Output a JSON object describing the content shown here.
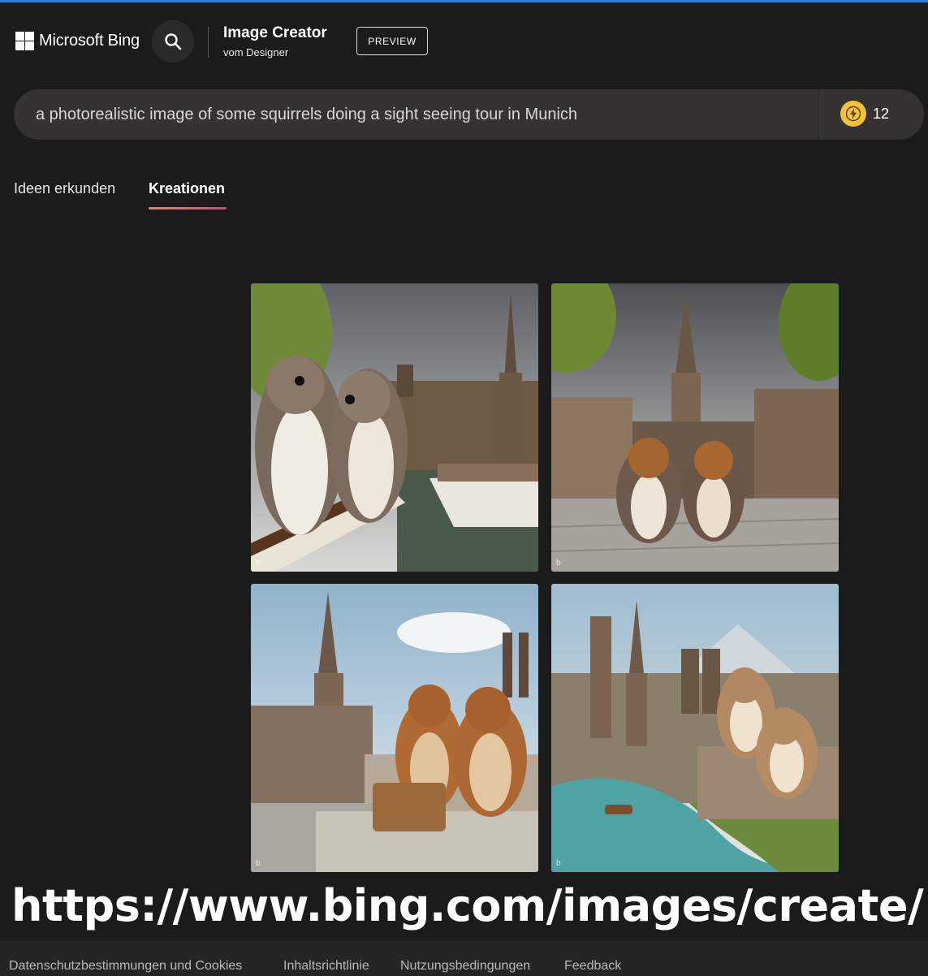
{
  "header": {
    "brand": "Microsoft Bing",
    "app_title": "Image Creator",
    "app_subtitle": "vom Designer",
    "badge": "PREVIEW"
  },
  "prompt": {
    "value": "a photorealistic image of some squirrels doing a sight seeing tour in Munich",
    "boosts": "12",
    "boost_icon": "lightning-coin-icon"
  },
  "tabs": [
    {
      "label": "Ideen erkunden",
      "active": false
    },
    {
      "label": "Kreationen",
      "active": true
    }
  ],
  "images": [
    {
      "name": "squirrels-on-boat-railing",
      "icon": "bing-watermark-icon"
    },
    {
      "name": "squirrels-in-marienplatz",
      "icon": "bing-watermark-icon"
    },
    {
      "name": "squirrels-with-basket-overlook",
      "icon": "bing-watermark-icon"
    },
    {
      "name": "squirrels-over-munich-river",
      "icon": "bing-watermark-icon"
    }
  ],
  "overlay_url": "https://www.bing.com/images/create/",
  "footer": {
    "links": [
      "Datenschutzbestimmungen und Cookies",
      "Inhaltsrichtlinie",
      "Nutzungsbedingungen",
      "Feedback"
    ]
  },
  "colors": {
    "background": "#1c1b1b",
    "prompt_bar": "#343332",
    "accent_underline": "#d9417d",
    "boost_coin": "#f2c23a"
  }
}
